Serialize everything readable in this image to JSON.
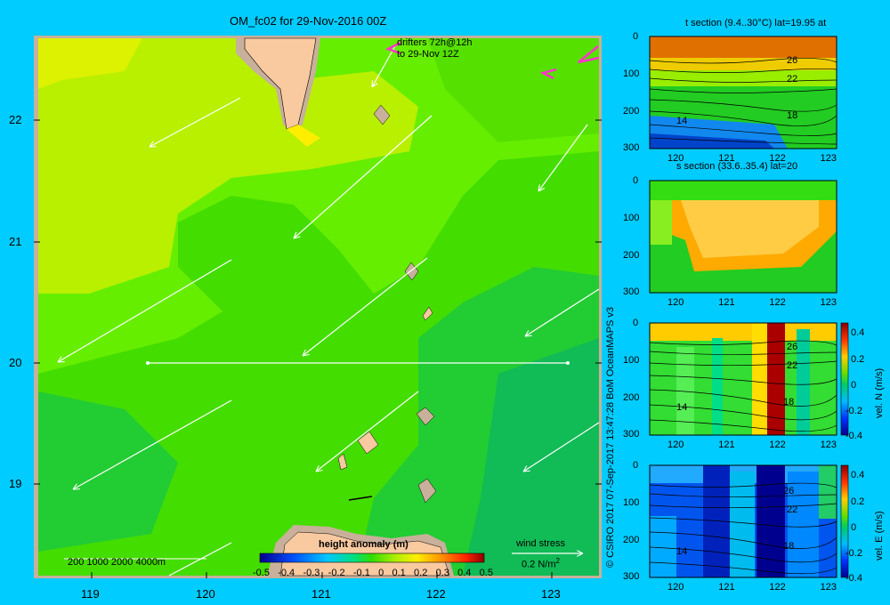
{
  "map": {
    "title": "OM_fc02 for 29-Nov-2016 00Z",
    "drifters_line1": "drifters 72h@12h",
    "drifters_line2": "to 29-Nov 12Z",
    "lat_ticks": [
      "22",
      "21",
      "20",
      "19"
    ],
    "lon_ticks": [
      "119",
      "120",
      "121",
      "122",
      "123"
    ],
    "depth_legend": "200  1000  2000  4000m",
    "colorbar_title": "height anomaly (m)",
    "colorbar_ticks": [
      "-0.5",
      "-0.4",
      "-0.3",
      "-0.2",
      "-0.1",
      "0",
      "0.1",
      "0.2",
      "0.3",
      "0.4",
      "0.5"
    ],
    "wind_title": "wind stress",
    "wind_scale": "0.2 N/m",
    "wind_scale_sup": "2",
    "colors": {
      "land": "#f9c9a0",
      "shelf": "#c8b09a",
      "drifter": "#ff33cc",
      "background": "#00ccff"
    }
  },
  "credit": "© CSIRO 2017   07-Sep-2017 13:47:28 BoM OceanMAPS v3",
  "panels": [
    {
      "title": "t section (9.4..30°C) lat=19.95 at",
      "depth_ticks": [
        "0",
        "100",
        "200",
        "300"
      ],
      "lon_ticks": [
        "120",
        "121",
        "122",
        "123"
      ],
      "contour_labels": [
        "26",
        "22",
        "18",
        "14"
      ],
      "colorbar": null
    },
    {
      "title": "s section (33.6..35.4) lat=20",
      "depth_ticks": [
        "0",
        "100",
        "200",
        "300"
      ],
      "lon_ticks": [
        "120",
        "121",
        "122",
        "123"
      ],
      "contour_labels": [],
      "colorbar": null
    },
    {
      "title": "",
      "depth_ticks": [
        "0",
        "100",
        "200",
        "300"
      ],
      "lon_ticks": [
        "120",
        "121",
        "122",
        "123"
      ],
      "contour_labels": [
        "26",
        "22",
        "18",
        "14"
      ],
      "colorbar": {
        "ticks": [
          "0.4",
          "0.2",
          "0",
          "-0.2",
          "-0.4"
        ],
        "label": "vel. N (m/s)"
      }
    },
    {
      "title": "",
      "depth_ticks": [
        "0",
        "100",
        "200",
        "300"
      ],
      "lon_ticks": [
        "120",
        "121",
        "122",
        "123"
      ],
      "contour_labels": [
        "26",
        "22",
        "18",
        "14"
      ],
      "colorbar": {
        "ticks": [
          "0.4",
          "0.2",
          "0",
          "-0.2",
          "-0.4"
        ],
        "label": "vel. E (m/s)"
      }
    }
  ]
}
